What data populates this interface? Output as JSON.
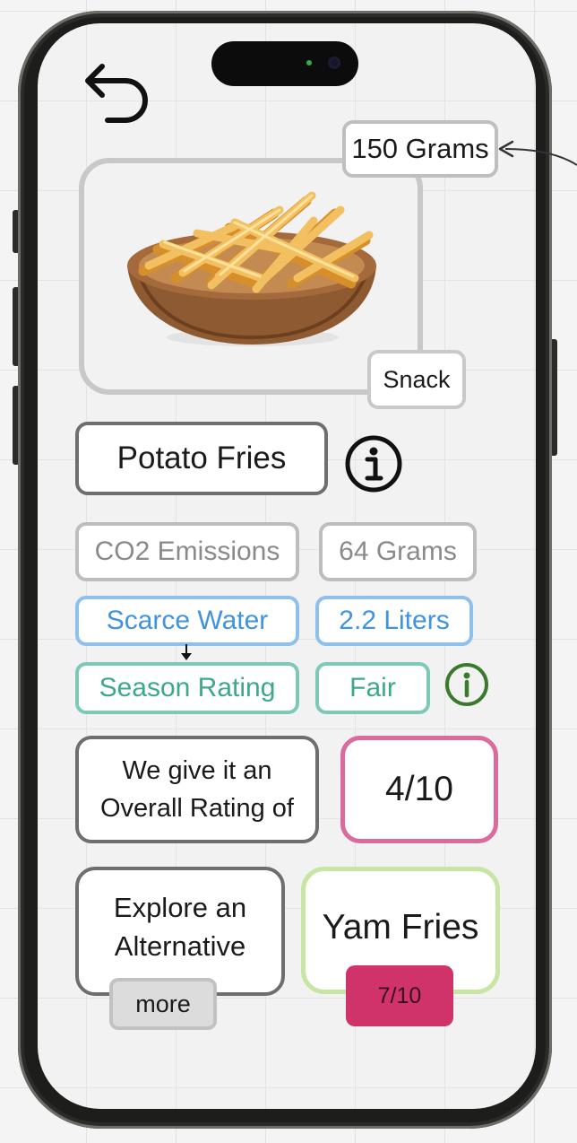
{
  "portion": {
    "label": "150 Grams"
  },
  "food": {
    "category": "Snack",
    "name": "Potato Fries"
  },
  "metrics": [
    {
      "label": "CO2 Emissions",
      "value": "64 Grams"
    },
    {
      "label": "Scarce Water",
      "value": "2.2 Liters"
    },
    {
      "label": "Season Rating",
      "value": "Fair"
    }
  ],
  "rating": {
    "line1": "We give it an",
    "line2": "Overall Rating of",
    "score": "4/10"
  },
  "alternative": {
    "prompt_line1": "Explore an",
    "prompt_line2": "Alternative",
    "more_label": "more",
    "name": "Yam Fries",
    "score": "7/10"
  },
  "icons": {
    "back": "back-arrow-icon",
    "info": "info-icon",
    "season_info": "info-icon"
  },
  "colors": {
    "co2": "#bdbdbd",
    "water": "#8ec0ee",
    "season": "#7ec9b5",
    "rating": "#db6b9d",
    "alternative": "#c7e6a4",
    "alt_badge": "#d0336a",
    "season_info_icon": "#3a7a2c"
  }
}
